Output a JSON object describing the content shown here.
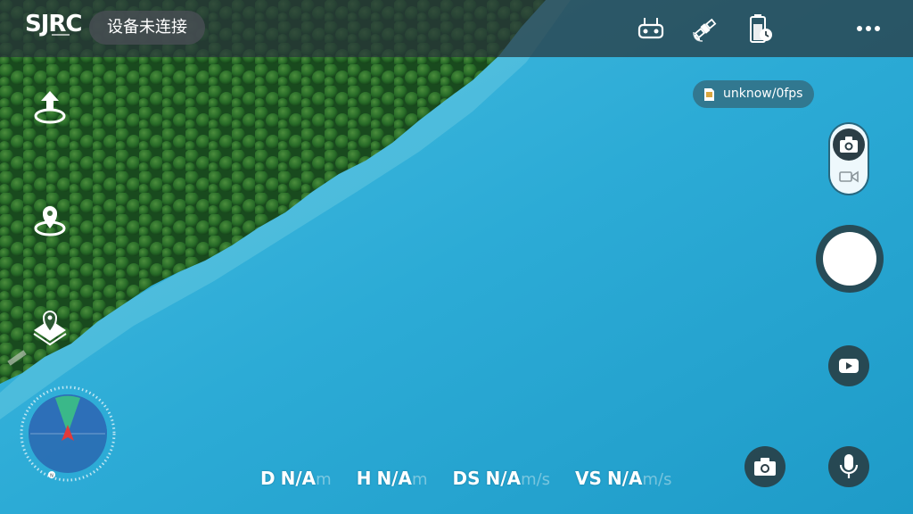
{
  "topbar": {
    "logo": "SJRC",
    "connection_status": "设备未连接",
    "icons": [
      "remote-controller-icon",
      "satellite-icon",
      "battery-timer-icon",
      "more-icon"
    ]
  },
  "sd_card": {
    "icon": "sd-card-icon",
    "status": "unknow/0fps"
  },
  "left_controls": [
    "takeoff-icon",
    "home-point-icon",
    "waypoint-icon"
  ],
  "right_controls": {
    "mode_switch": [
      "photo-mode-icon",
      "video-mode-icon"
    ],
    "shutter": "shutter-button",
    "playback": "play-icon",
    "gallery": "camera-icon",
    "voice": "microphone-icon"
  },
  "telemetry": [
    {
      "label": "D",
      "value": "N/A",
      "unit": "m"
    },
    {
      "label": "H",
      "value": "N/A",
      "unit": "m"
    },
    {
      "label": "DS",
      "value": "N/A",
      "unit": "m/s"
    },
    {
      "label": "VS",
      "value": "N/A",
      "unit": "m/s"
    }
  ],
  "colors": {
    "topbar_bg": "#28343a",
    "water": "#2aa9d4",
    "forest": "#2f6b2a",
    "control_bg": "#2c3e46",
    "compass_arrow": "#e23a3a",
    "compass_cone": "#3fd07a"
  }
}
